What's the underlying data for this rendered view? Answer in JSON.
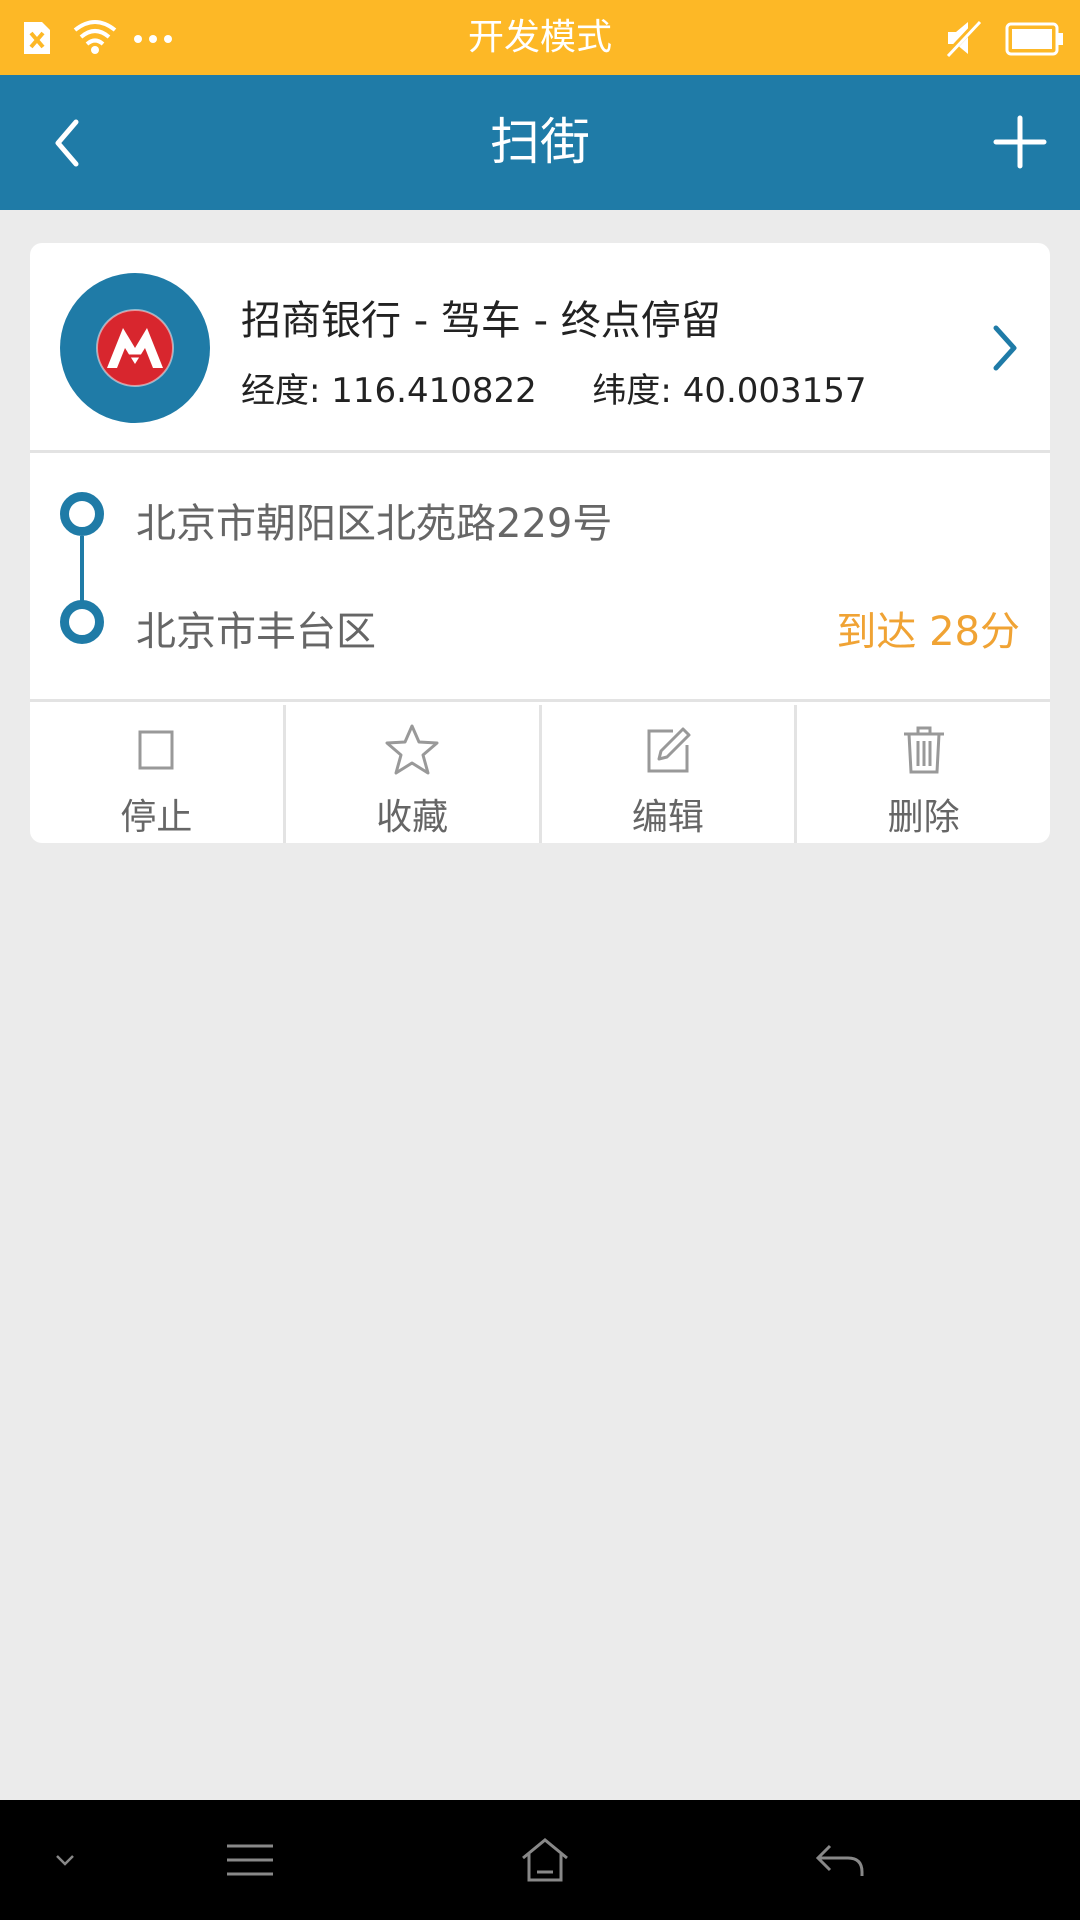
{
  "status_bar": {
    "title": "开发模式",
    "icons": [
      "sim-icon",
      "wifi-icon",
      "more-dots-icon",
      "mute-icon",
      "battery-icon"
    ]
  },
  "header": {
    "title": "扫街",
    "back_icon": "chevron-left-icon",
    "add_icon": "plus-icon"
  },
  "card": {
    "title": "招商银行 - 驾车 - 终点停留",
    "longitude_label": "经度:",
    "longitude": "116.410822",
    "latitude_label": "纬度:",
    "latitude": "40.003157",
    "logo_icon": "bank-logo-icon",
    "route": {
      "start": "北京市朝阳区北苑路229号",
      "end": "北京市丰台区",
      "arrival": "到达 28分"
    },
    "actions": [
      {
        "label": "停止",
        "icon": "stop-square-icon"
      },
      {
        "label": "收藏",
        "icon": "star-icon"
      },
      {
        "label": "编辑",
        "icon": "edit-icon"
      },
      {
        "label": "删除",
        "icon": "trash-icon"
      }
    ]
  },
  "nav_bar": {
    "icons": [
      "collapse-down-icon",
      "menu-icon",
      "home-icon",
      "back-icon"
    ]
  },
  "colors": {
    "status_bar": "#fdb826",
    "header": "#1f7ba7",
    "accent_orange": "#f0a334",
    "background": "#ebebeb"
  }
}
